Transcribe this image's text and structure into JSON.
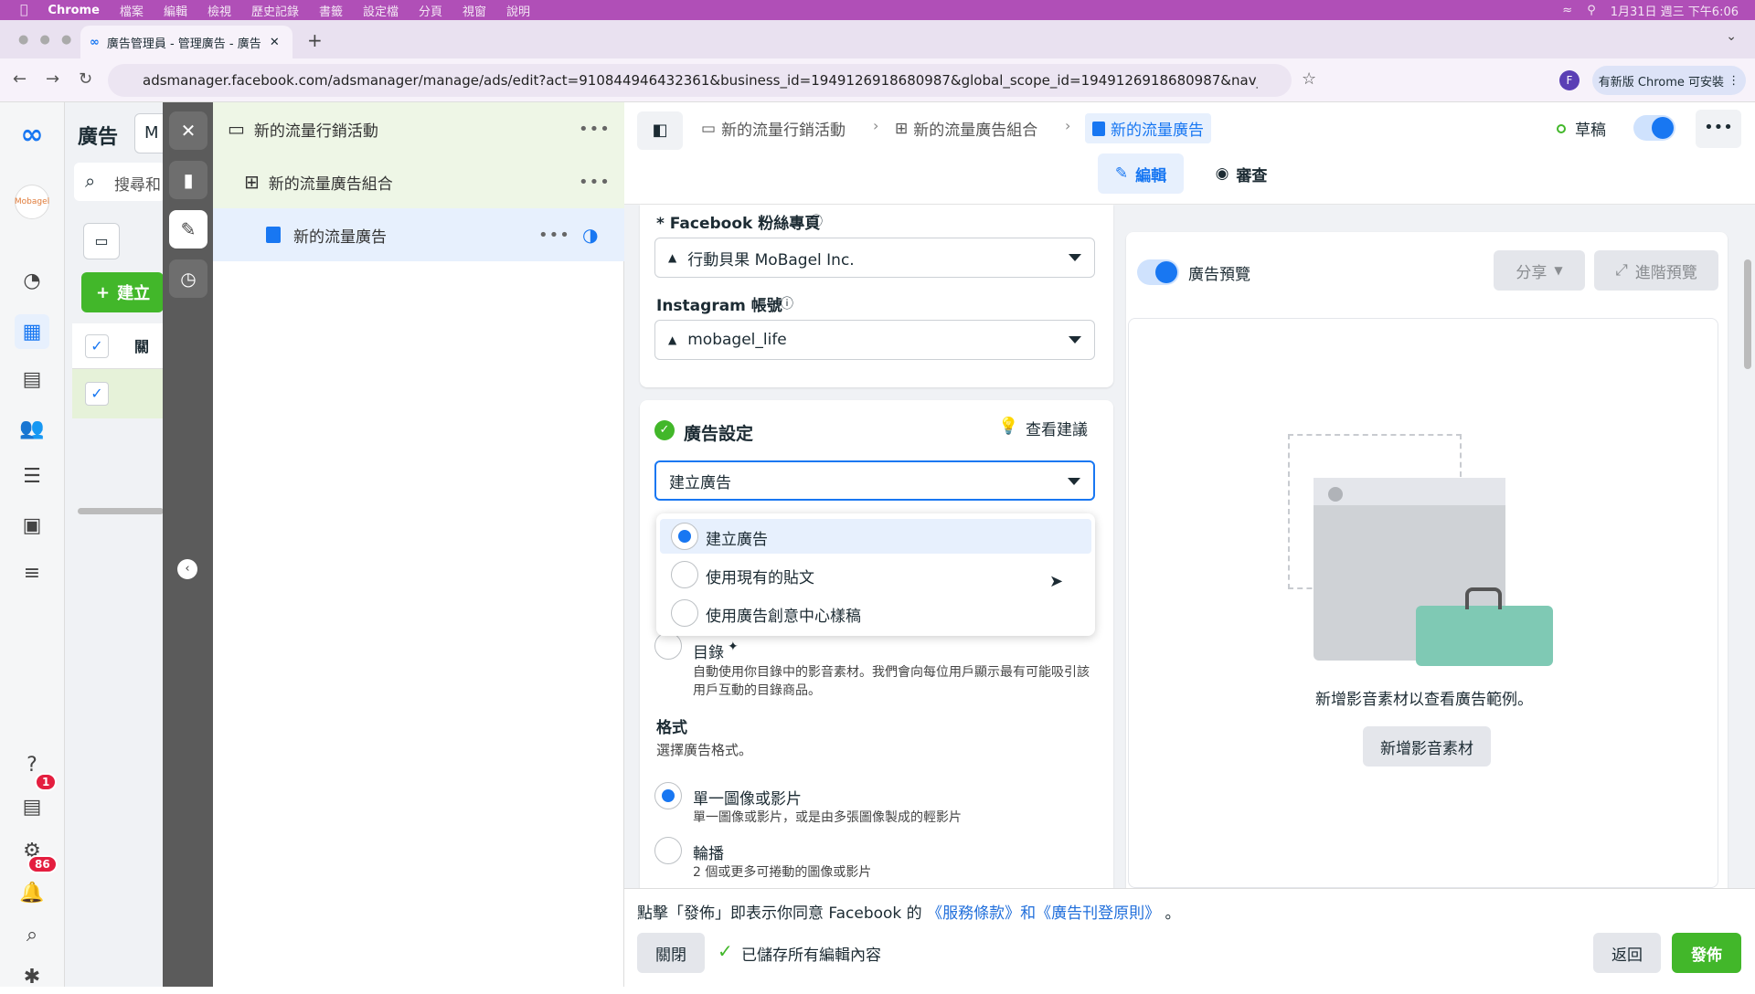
{
  "menubar": {
    "app": "Chrome",
    "items": [
      "檔案",
      "編輯",
      "檢視",
      "歷史記錄",
      "書籤",
      "設定檔",
      "分頁",
      "視窗",
      "說明"
    ],
    "clock": "1月31日 週三 下午6:06"
  },
  "browser": {
    "tab_title": "廣告管理員 - 管理廣告 - 廣告",
    "url": "adsmanager.facebook.com/adsmanager/manage/ads/edit?act=910844946432361&business_id=1949126918680987&global_scope_id=1949126918680987&nav_entry_point=am_loca...",
    "update_label": "有新版 Chrome 可安裝",
    "profile_initial": "F"
  },
  "rail": {
    "help_badge": "1",
    "notif_badge": "86"
  },
  "under": {
    "title": "廣告",
    "account_partial": "M",
    "search_partial": "搜尋和",
    "create_button": "建立",
    "col_header_partial": "關"
  },
  "tree": {
    "campaign": "新的流量行銷活動",
    "adset": "新的流量廣告組合",
    "ad": "新的流量廣告"
  },
  "topnav": {
    "crumb_campaign": "新的流量行銷活動",
    "crumb_adset": "新的流量廣告組合",
    "crumb_ad": "新的流量廣告",
    "status": "草稿",
    "tab_edit": "編輯",
    "tab_review": "審查"
  },
  "identity": {
    "fb_page_label": "* Facebook 粉絲專頁",
    "fb_page_value": "行動貝果 MoBagel Inc.",
    "ig_label": "Instagram 帳號",
    "ig_value": "mobagel_life"
  },
  "ad_setup": {
    "title": "廣告設定",
    "suggest": "查看建議",
    "select_value": "建立廣告",
    "options": [
      "建立廣告",
      "使用現有的貼文",
      "使用廣告創意中心樣稿"
    ],
    "catalog_label": "目錄",
    "catalog_desc": "自動使用你目錄中的影音素材。我們會向每位用戶顯示最有可能吸引該用戶互動的目錄商品。",
    "format_title": "格式",
    "format_sub": "選擇廣告格式。",
    "format_single": "單一圖像或影片",
    "format_single_desc": "單一圖像或影片，或是由多張圖像製成的輕影片",
    "format_carousel": "輪播",
    "format_carousel_desc": "2 個或更多可捲動的圖像或影片"
  },
  "preview": {
    "toggle_label": "廣告預覽",
    "share": "分享",
    "advanced": "進階預覽",
    "empty_text": "新增影音素材以查看廣告範例。",
    "add_media": "新增影音素材"
  },
  "bottom": {
    "terms_prefix": "點擊「發佈」即表示你同意 Facebook 的",
    "terms_link": "《服務條款》和《廣告刊登原則》",
    "terms_suffix": "。",
    "close": "關閉",
    "saved": "已儲存所有編輯內容",
    "back": "返回",
    "publish": "發佈"
  },
  "colors": {
    "accent": "#1877f2",
    "publish_green": "#42b72a",
    "menubar": "#b04fb7"
  }
}
